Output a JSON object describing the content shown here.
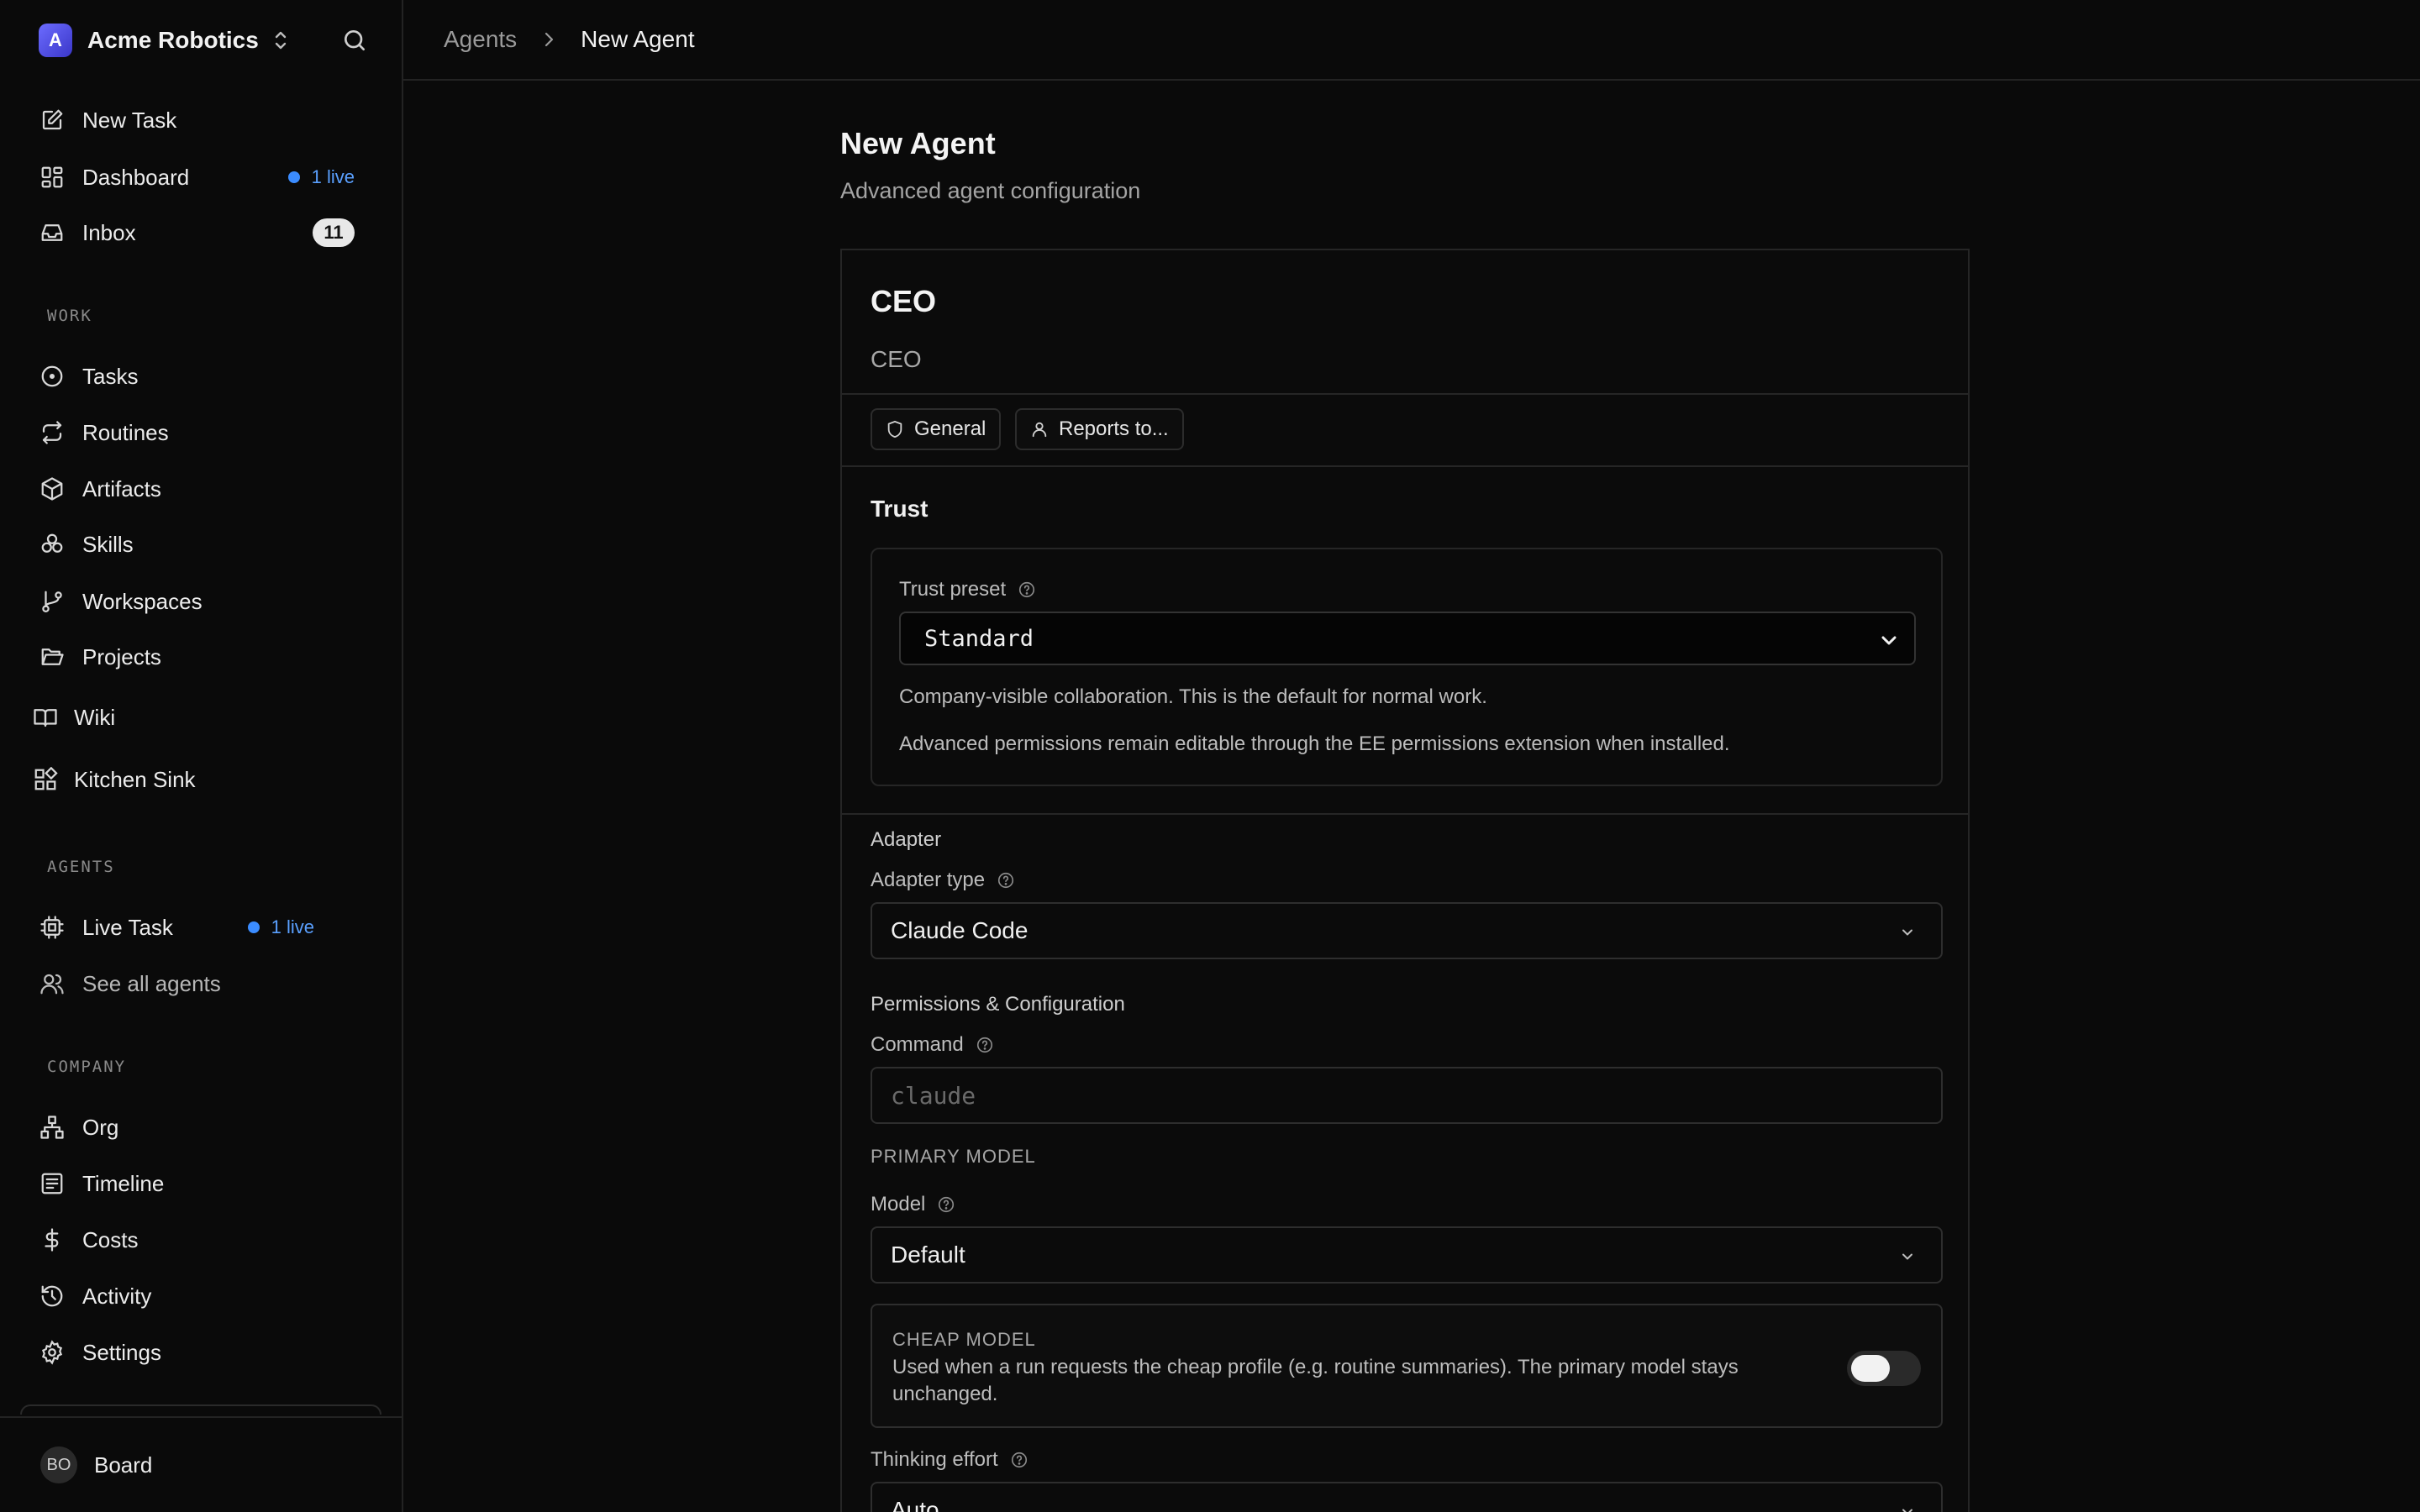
{
  "sidebar": {
    "company": {
      "initial": "A",
      "name": "Acme Robotics"
    },
    "top_items": [
      {
        "label": "New Task",
        "icon": "pencil-square-icon"
      },
      {
        "label": "Dashboard",
        "icon": "dashboard-grid-icon",
        "live": "1 live"
      },
      {
        "label": "Inbox",
        "icon": "inbox-icon",
        "count": "11"
      }
    ],
    "work": {
      "title": "WORK",
      "items": [
        {
          "label": "Tasks",
          "icon": "circle-dot-icon"
        },
        {
          "label": "Routines",
          "icon": "repeat-icon"
        },
        {
          "label": "Artifacts",
          "icon": "package-icon"
        },
        {
          "label": "Skills",
          "icon": "boxes-icon"
        },
        {
          "label": "Workspaces",
          "icon": "git-branch-icon"
        },
        {
          "label": "Projects",
          "icon": "folder-open-icon"
        },
        {
          "label": "Wiki",
          "icon": "book-open-icon"
        },
        {
          "label": "Kitchen Sink",
          "icon": "blocks-icon"
        }
      ]
    },
    "agents": {
      "title": "AGENTS",
      "items": [
        {
          "label": "Live Task",
          "icon": "cpu-icon",
          "live": "1 live"
        },
        {
          "label": "See all agents",
          "icon": "users-icon"
        }
      ]
    },
    "company_section": {
      "title": "COMPANY",
      "items": [
        {
          "label": "Org",
          "icon": "org-chart-icon"
        },
        {
          "label": "Timeline",
          "icon": "timeline-list-icon"
        },
        {
          "label": "Costs",
          "icon": "dollar-icon"
        },
        {
          "label": "Activity",
          "icon": "history-icon"
        },
        {
          "label": "Settings",
          "icon": "gear-icon"
        }
      ]
    },
    "user": {
      "initials": "BO",
      "name": "Board"
    }
  },
  "breadcrumb": {
    "parent": "Agents",
    "current": "New Agent"
  },
  "page": {
    "title": "New Agent",
    "subtitle": "Advanced agent configuration"
  },
  "agent": {
    "name": "CEO",
    "title": "CEO",
    "chips": {
      "general": "General",
      "reports_to": "Reports to..."
    }
  },
  "trust": {
    "heading": "Trust",
    "preset_label": "Trust preset",
    "preset_value": "Standard",
    "description": "Company-visible collaboration. This is the default for normal work.",
    "note": "Advanced permissions remain editable through the EE permissions extension when installed."
  },
  "adapter": {
    "heading": "Adapter",
    "type_label": "Adapter type",
    "type_value": "Claude Code"
  },
  "permissions": {
    "heading": "Permissions & Configuration",
    "command_label": "Command",
    "command_placeholder": "claude",
    "primary_model_heading": "PRIMARY MODEL",
    "model_label": "Model",
    "model_value": "Default",
    "cheap_model_title": "CHEAP MODEL",
    "cheap_model_desc": "Used when a run requests the cheap profile (e.g. routine summaries). The primary model stays unchanged.",
    "cheap_model_enabled": false,
    "thinking_label": "Thinking effort",
    "thinking_value": "Auto"
  },
  "colors": {
    "live": "#3b8cff",
    "background": "#0a0a0a",
    "border": "#262626"
  }
}
